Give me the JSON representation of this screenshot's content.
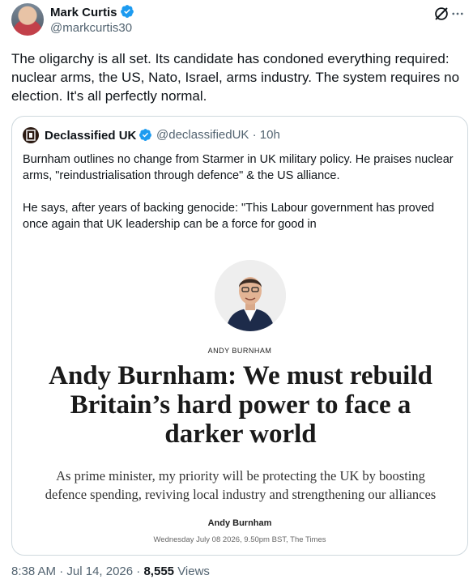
{
  "tweet": {
    "author_name": "Mark Curtis",
    "author_handle": "@markcurtis30",
    "text": "The oligarchy is all set. Its candidate has condoned everything required: nuclear arms, the US, Nato, Israel, arms industry. The system requires no election. It's all perfectly normal.",
    "time": "8:38 AM",
    "date": "Jul 14, 2026",
    "separator": "·",
    "views_count": "8,555",
    "views_label": "Views"
  },
  "quote": {
    "author_name": "Declassified UK",
    "author_handle": "@declassifiedUK",
    "time": "· 10h",
    "paragraph1": "Burnham outlines no change from Starmer in UK military policy. He praises nuclear arms, \"reindustrialisation through defence\" & the US alliance.",
    "paragraph2": "He says, after years of backing genocide: \"This Labour government has proved once again that UK leadership can be a force for good in"
  },
  "article": {
    "author_caps": "ANDY BURNHAM",
    "headline": "Andy Burnham: We must rebuild Britain’s hard power to face a darker world",
    "standfirst": "As prime minister, my priority will be protecting the UK by boosting defence spending, reviving local industry and strengthening our alliances",
    "author": "Andy Burnham",
    "dateline": "Wednesday July 08 2026, 9.50pm BST, The Times"
  },
  "colors": {
    "verified": "#1d9bf0",
    "secondary_text": "#536471",
    "border": "#cfd9de"
  }
}
